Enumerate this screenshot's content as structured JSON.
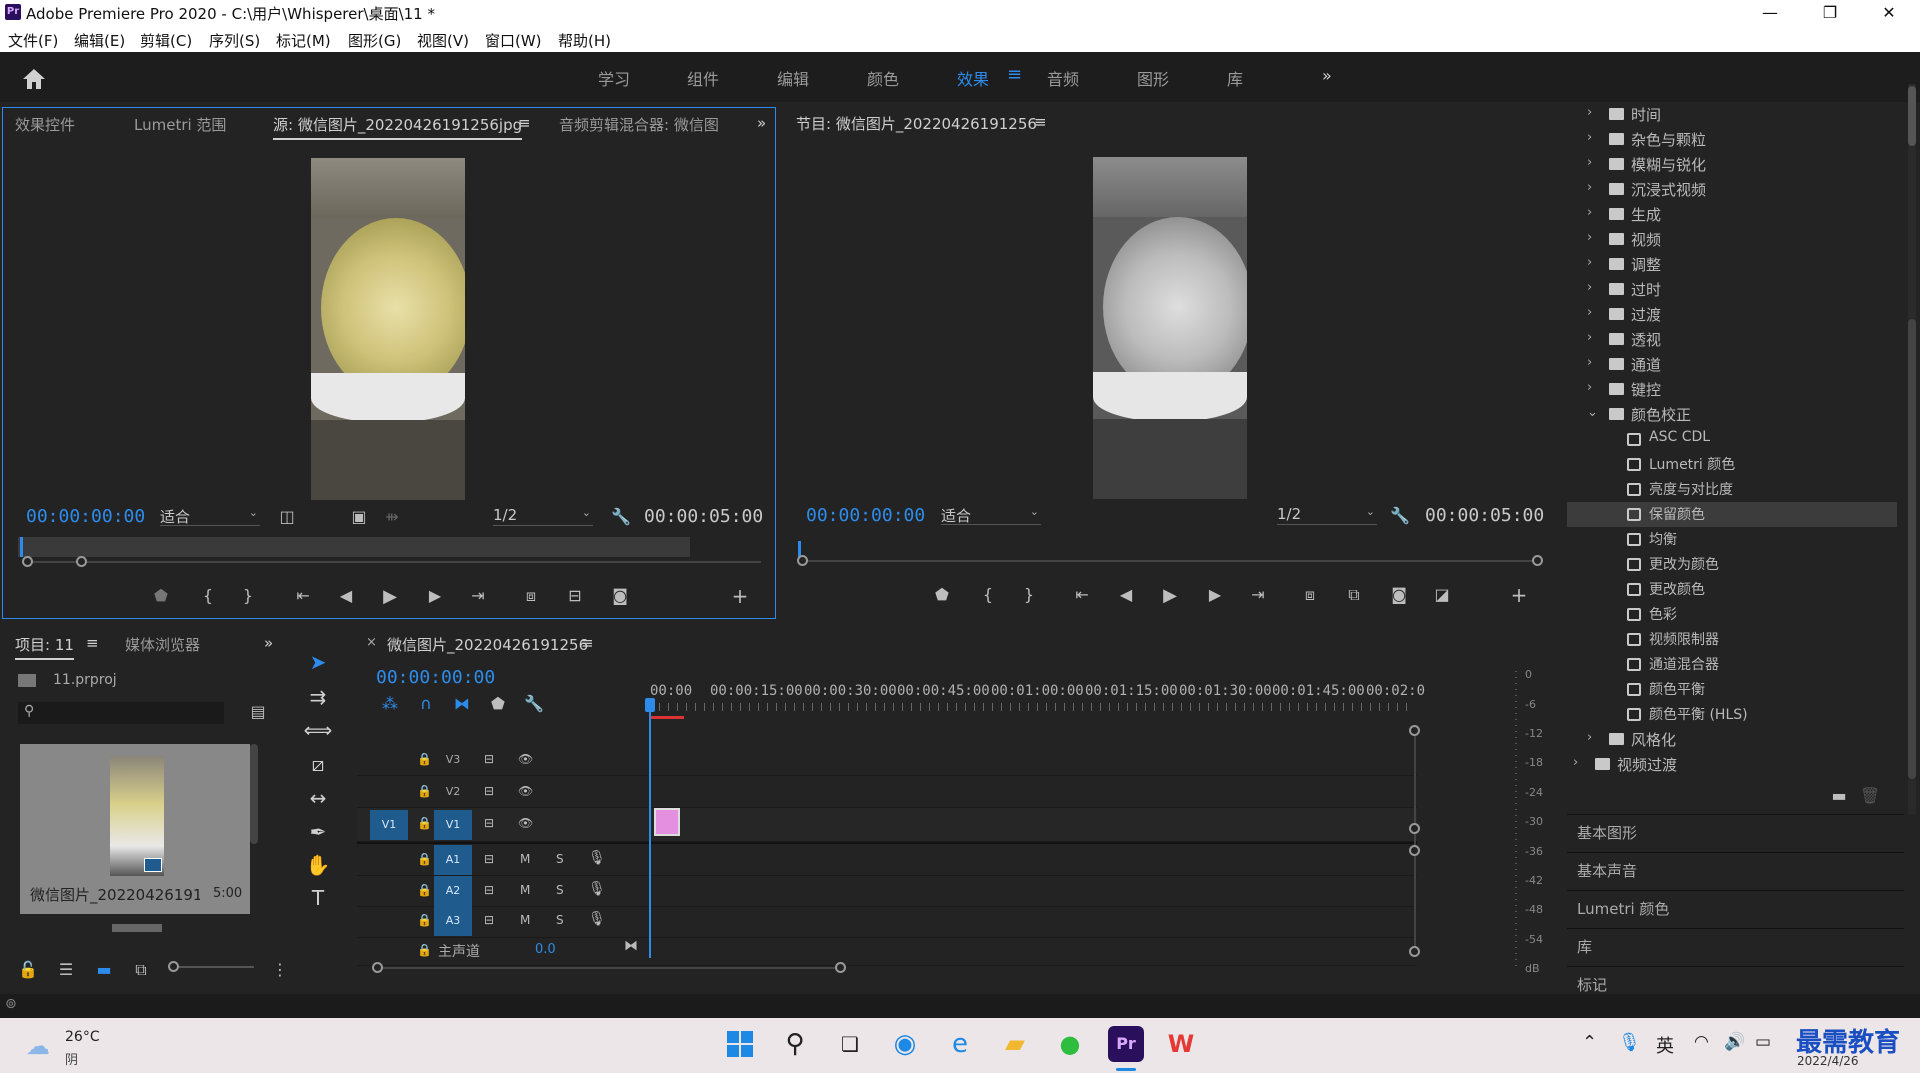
{
  "window": {
    "title": "Adobe Premiere Pro 2020 - C:\\用户\\Whisperer\\桌面\\11 *",
    "logo": "Pr",
    "minimize": "—",
    "restore": "❐",
    "close": "✕"
  },
  "menu": [
    "文件(F)",
    "编辑(E)",
    "剪辑(C)",
    "序列(S)",
    "标记(M)",
    "图形(G)",
    "视图(V)",
    "窗口(W)",
    "帮助(H)"
  ],
  "workspaces": {
    "items": [
      "学习",
      "组件",
      "编辑",
      "颜色",
      "效果",
      "音频",
      "图形",
      "库"
    ],
    "active": "效果",
    "more": "»"
  },
  "source_panel": {
    "tabs": [
      "效果控件",
      "Lumetri 范围",
      "源: 微信图片_20220426191256jpg",
      "音频剪辑混合器: 微信图"
    ],
    "active_tab_menu": "≡",
    "more": "»",
    "timecode": "00:00:00:00",
    "fit": "适合",
    "resolution": "1/2",
    "duration": "00:00:05:00"
  },
  "program_panel": {
    "title": "节目: 微信图片_20220426191256",
    "menu": "≡",
    "timecode": "00:00:00:00",
    "fit": "适合",
    "resolution": "1/2",
    "duration": "00:00:05:00"
  },
  "effects_tree": [
    {
      "label": "时间",
      "type": "folder",
      "expanded": false
    },
    {
      "label": "杂色与颗粒",
      "type": "folder",
      "expanded": false
    },
    {
      "label": "模糊与锐化",
      "type": "folder",
      "expanded": false
    },
    {
      "label": "沉浸式视频",
      "type": "folder",
      "expanded": false
    },
    {
      "label": "生成",
      "type": "folder",
      "expanded": false
    },
    {
      "label": "视频",
      "type": "folder",
      "expanded": false
    },
    {
      "label": "调整",
      "type": "folder",
      "expanded": false
    },
    {
      "label": "过时",
      "type": "folder",
      "expanded": false
    },
    {
      "label": "过渡",
      "type": "folder",
      "expanded": false
    },
    {
      "label": "透视",
      "type": "folder",
      "expanded": false
    },
    {
      "label": "通道",
      "type": "folder",
      "expanded": false
    },
    {
      "label": "键控",
      "type": "folder",
      "expanded": false
    },
    {
      "label": "颜色校正",
      "type": "folder",
      "expanded": true
    },
    {
      "label": "ASC CDL",
      "type": "effect"
    },
    {
      "label": "Lumetri 颜色",
      "type": "effect"
    },
    {
      "label": "亮度与对比度",
      "type": "effect"
    },
    {
      "label": "保留颜色",
      "type": "effect",
      "selected": true
    },
    {
      "label": "均衡",
      "type": "effect"
    },
    {
      "label": "更改为颜色",
      "type": "effect"
    },
    {
      "label": "更改颜色",
      "type": "effect"
    },
    {
      "label": "色彩",
      "type": "effect"
    },
    {
      "label": "视频限制器",
      "type": "effect"
    },
    {
      "label": "通道混合器",
      "type": "effect"
    },
    {
      "label": "颜色平衡",
      "type": "effect"
    },
    {
      "label": "颜色平衡 (HLS)",
      "type": "effect"
    },
    {
      "label": "风格化",
      "type": "folder",
      "expanded": false
    },
    {
      "label": "视频过渡",
      "type": "folder",
      "expanded": false,
      "level": 0
    }
  ],
  "side_sections": [
    "基本图形",
    "基本声音",
    "Lumetri 颜色",
    "库",
    "标记"
  ],
  "project_panel": {
    "tabs": [
      "项目: 11",
      "媒体浏览器"
    ],
    "menu": "≡",
    "more": "»",
    "file": "11.prproj",
    "clip_name": "微信图片_20220426191...",
    "clip_duration": "5:00"
  },
  "timeline": {
    "tab_close": "×",
    "tab_title": "微信图片_20220426191256",
    "menu": "≡",
    "timecode": "00:00:00:00",
    "ruler": [
      "00:00",
      "00:00:15:00",
      "00:00:30:00",
      "00:00:45:00",
      "00:01:00:00",
      "00:01:15:00",
      "00:01:30:00",
      "00:01:45:00",
      "00:02:0"
    ],
    "video_tracks": [
      "V3",
      "V2",
      "V1"
    ],
    "audio_tracks": [
      "A1",
      "A2",
      "A3"
    ],
    "source_patch": "V1",
    "master_label": "主声道",
    "master_value": "0.0",
    "mute": "M",
    "solo": "S"
  },
  "meter_scale": [
    "0",
    "-6",
    "-12",
    "-18",
    "-24",
    "-30",
    "-36",
    "-42",
    "-48",
    "-54",
    "dB"
  ],
  "taskbar": {
    "temperature": "26°C",
    "weather": "阴",
    "lang": "英",
    "date": "2022/4/26",
    "watermark": "最需教育"
  },
  "colors": {
    "accent": "#2d8ceb",
    "panel_bg": "#232323",
    "clip_pink": "#e58fe0",
    "playhead": "#2d8ceb"
  }
}
